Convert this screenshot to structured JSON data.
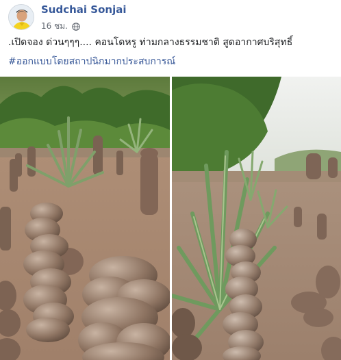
{
  "post": {
    "author": "Sudchai Sonjai",
    "time": "16 ชม.",
    "audience_icon": "globe-icon",
    "text": ".เปิดจอง ด่วนๆๆๆ.... คอนโดหรู ท่ามกลางธรรมชาติ สูดอากาศบริสุทธิ์",
    "hashtag": "#ออกแบบโดยสถาปนิกมากประสบการณ์"
  },
  "photos": [
    {
      "subject": "termite-mound-field-photo-left"
    },
    {
      "subject": "termite-mound-field-photo-right"
    }
  ],
  "colors": {
    "author_link": "#365899",
    "hashtag": "#385898",
    "meta_text": "#616770",
    "body_text": "#1c1e21"
  }
}
